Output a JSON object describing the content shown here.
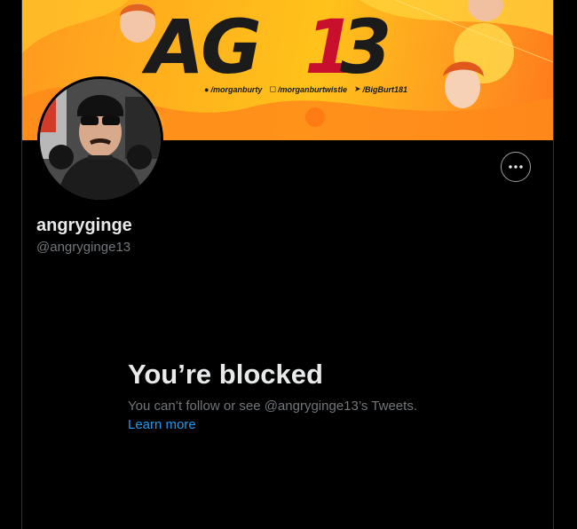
{
  "banner": {
    "logo_text": "AG13",
    "socials": [
      {
        "icon": "snapchat-icon",
        "label": "/morganburty"
      },
      {
        "icon": "instagram-icon",
        "label": "/morganburtwistle"
      },
      {
        "icon": "twitter-icon",
        "label": "/BigBurt181"
      }
    ]
  },
  "profile": {
    "display_name": "angryginge",
    "handle": "@angryginge13",
    "more_button_icon": "more-horizontal-icon"
  },
  "blocked": {
    "title": "You’re blocked",
    "description": "You can’t follow or see @angryginge13’s Tweets.",
    "link": "Learn more"
  },
  "colors": {
    "background": "#000000",
    "primary_text": "#e7e9ea",
    "secondary_text": "#71767b",
    "link": "#1d9bf0",
    "banner_orange": "#ffb21c",
    "logo_red": "#c8102e"
  }
}
